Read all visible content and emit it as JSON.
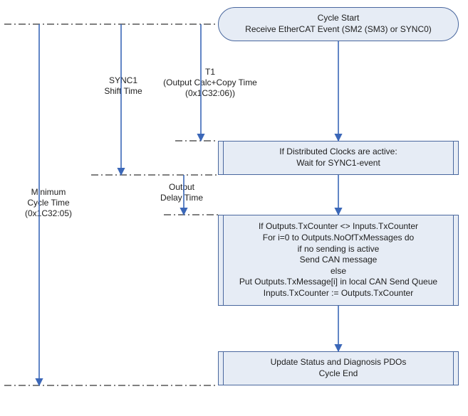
{
  "nodes": {
    "start": {
      "line1": "Cycle Start",
      "line2": "Receive EtherCAT Event (SM2 (SM3) or SYNC0)"
    },
    "sync1": {
      "line1": "If Distributed Clocks are active:",
      "line2": "Wait for SYNC1-event"
    },
    "txblock": {
      "line1": "If Outputs.TxCounter <> Inputs.TxCounter",
      "line2": "For i=0 to Outputs.NoOfTxMessages do",
      "line3": "if no sending is active",
      "line4": "Send CAN message",
      "line5": "else",
      "line6": "Put Outputs.TxMessage[i] in local CAN Send Queue",
      "line7": "Inputs.TxCounter := Outputs.TxCounter"
    },
    "end": {
      "line1": "Update Status and Diagnosis PDOs",
      "line2": "Cycle End"
    }
  },
  "labels": {
    "min_cycle": "Minimum\nCycle Time\n(0x1C32:05)",
    "sync1_shift": "SYNC1\nShift Time",
    "t1": "T1\n(Output Calc+Copy Time\n(0x1C32:06))",
    "output_delay": "Output\nDelay Time"
  },
  "chart_data": {
    "type": "flowchart",
    "title": "",
    "nodes": [
      {
        "id": "start",
        "type": "terminator",
        "text": "Cycle Start\nReceive EtherCAT Event (SM2 (SM3) or SYNC0)"
      },
      {
        "id": "sync1",
        "type": "process",
        "text": "If Distributed Clocks are active:\nWait for SYNC1-event"
      },
      {
        "id": "txblock",
        "type": "process",
        "text": "If Outputs.TxCounter <> Inputs.TxCounter\nFor i=0 to Outputs.NoOfTxMessages do\nif no sending is active\nSend CAN message\nelse\nPut Outputs.TxMessage[i] in local CAN Send Queue\nInputs.TxCounter := Outputs.TxCounter"
      },
      {
        "id": "end",
        "type": "process",
        "text": "Update Status and Diagnosis PDOs\nCycle End"
      }
    ],
    "edges": [
      {
        "from": "start",
        "to": "sync1"
      },
      {
        "from": "sync1",
        "to": "txblock"
      },
      {
        "from": "txblock",
        "to": "end"
      }
    ],
    "timing_markers": [
      {
        "name": "Minimum Cycle Time",
        "object": "0x1C32:05",
        "from": "start",
        "to": "end"
      },
      {
        "name": "SYNC1 Shift Time",
        "from": "start",
        "to": "sync1.end"
      },
      {
        "name": "T1 (Output Calc+Copy Time)",
        "object": "0x1C32:06",
        "from": "start",
        "to": "sync1.start"
      },
      {
        "name": "Output Delay Time",
        "from": "sync1.end",
        "to": "txblock.start"
      }
    ]
  }
}
